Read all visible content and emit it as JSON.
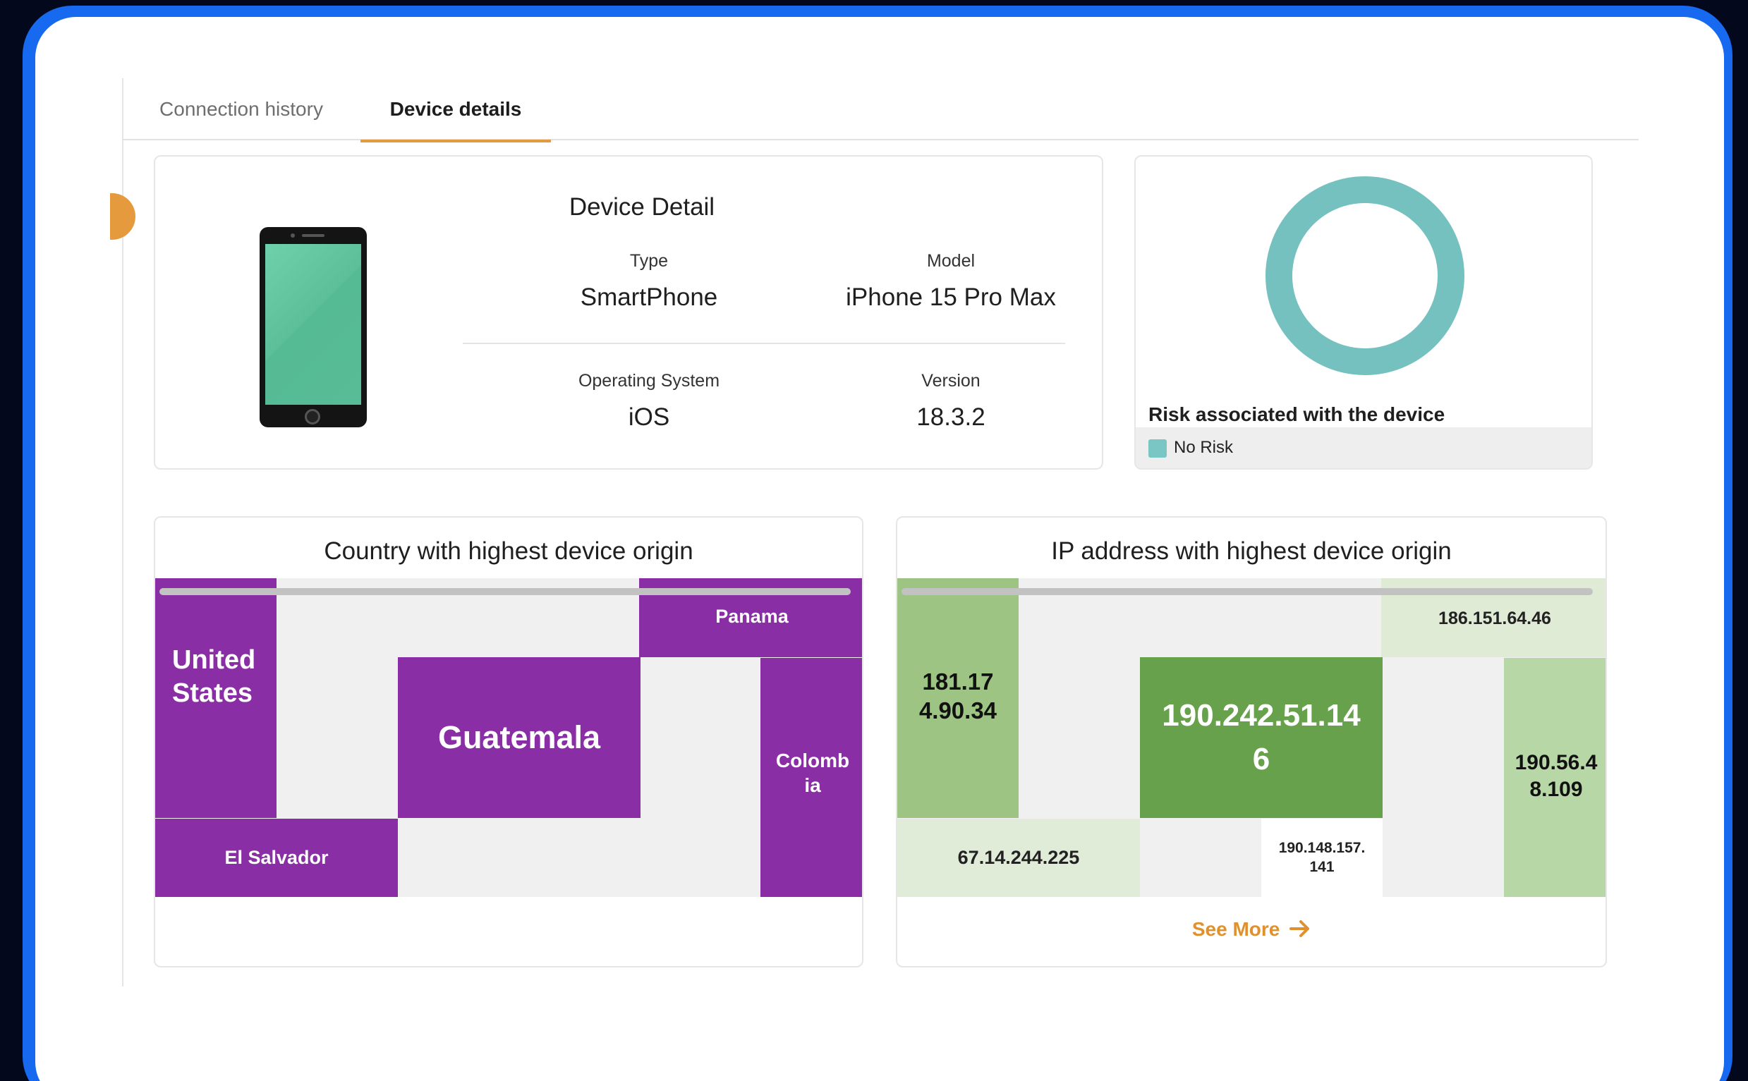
{
  "tabs": [
    {
      "label": "Connection history",
      "active": false
    },
    {
      "label": "Device details",
      "active": true
    }
  ],
  "device_detail": {
    "title": "Device Detail",
    "type_label": "Type",
    "type_value": "SmartPhone",
    "model_label": "Model",
    "model_value": "iPhone 15 Pro Max",
    "os_label": "Operating System",
    "os_value": "iOS",
    "version_label": "Version",
    "version_value": "18.3.2",
    "icon": "smartphone-icon"
  },
  "risk": {
    "title": "Risk associated with the device",
    "legend": [
      {
        "label": "No Risk",
        "color": "#75c1bf"
      }
    ],
    "share": {
      "No Risk": 1.0
    }
  },
  "country_treemap": {
    "title": "Country with highest device origin",
    "cells": [
      {
        "label": "United States",
        "color": "#8a2ea5"
      },
      {
        "label": "Panama",
        "color": "#8a2ea5"
      },
      {
        "label": "Guatemala",
        "color": "#8a2ea5"
      },
      {
        "label": "Colombia",
        "color": "#8a2ea5"
      },
      {
        "label": "El Salvador",
        "color": "#8a2ea5"
      }
    ]
  },
  "ip_treemap": {
    "title": "IP address with highest device origin",
    "cells": [
      {
        "label": "181.174.90.34",
        "display": "181.17\n4.90.34",
        "color": "#9ec483"
      },
      {
        "label": "186.151.64.46",
        "color": "#e0ebd6"
      },
      {
        "label": "190.242.51.146",
        "display": "190.242.51.14\n6",
        "color": "#67a14c"
      },
      {
        "label": "190.56.48.109",
        "display": "190.56.4\n8.109",
        "color": "#b8d7a7"
      },
      {
        "label": "67.14.244.225",
        "color": "#e1ecd8"
      },
      {
        "label": "190.148.157.141",
        "display": "190.148.157.\n141",
        "color": "#ffffff"
      }
    ],
    "see_more": "See More",
    "see_more_icon": "arrow-right-icon"
  },
  "accent": "#e39a41"
}
